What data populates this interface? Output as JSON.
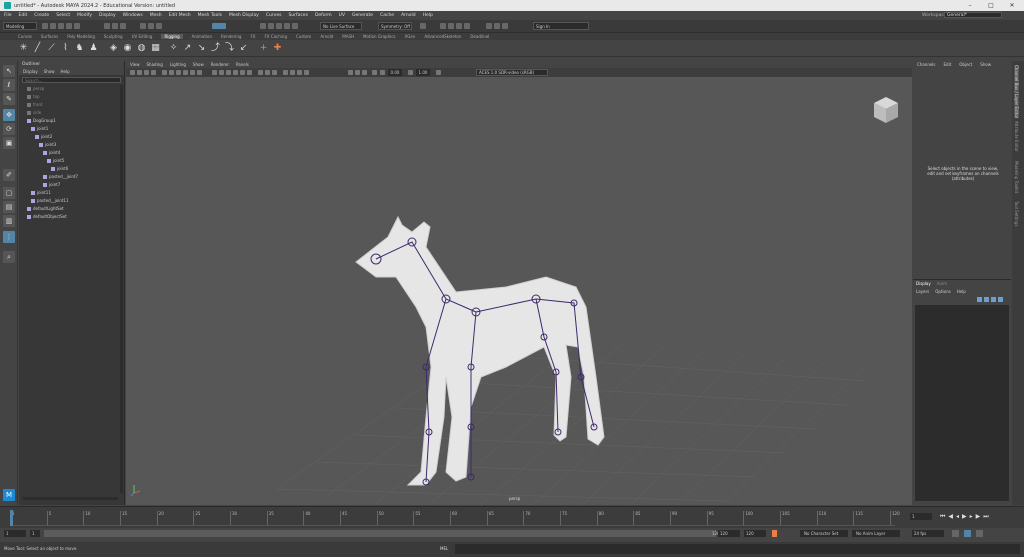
{
  "window": {
    "title": "untitled* - Autodesk MAYA 2024.2 - Educational Version: untitled"
  },
  "menubar": {
    "items": [
      "File",
      "Edit",
      "Create",
      "Select",
      "Modify",
      "Display",
      "Windows",
      "Mesh",
      "Edit Mesh",
      "Mesh Tools",
      "Mesh Display",
      "Curves",
      "Surfaces",
      "Deform",
      "UV",
      "Generate",
      "Cache",
      "Arnold",
      "Help"
    ]
  },
  "workspace": {
    "label": "Workspace:",
    "value": "General*"
  },
  "statusline": {
    "mode": "Modeling",
    "live_surface": "No Live Surface",
    "symmetry": "Symmetry: Off",
    "sign_in": "Sign In"
  },
  "shelf": {
    "tabs": [
      "Curves",
      "Surfaces",
      "Poly Modeling",
      "Sculpting",
      "UV Editing",
      "Rigging",
      "Animation",
      "Rendering",
      "FX",
      "FX Caching",
      "Custom",
      "Arnold",
      "MASH",
      "Motion Graphics",
      "XGen",
      "AdvancedSkeleton",
      "DeadlineI"
    ],
    "active_index": 5
  },
  "outliner": {
    "title": "Outliner",
    "menu": [
      "Display",
      "Show",
      "Help"
    ],
    "search_placeholder": "Search...",
    "rows": [
      {
        "label": "persp",
        "indent": 0,
        "dim": true
      },
      {
        "label": "top",
        "indent": 0,
        "dim": true
      },
      {
        "label": "front",
        "indent": 0,
        "dim": true
      },
      {
        "label": "side",
        "indent": 0,
        "dim": true
      },
      {
        "label": "DogGroup1",
        "indent": 0,
        "dim": false
      },
      {
        "label": "joint1",
        "indent": 1,
        "dim": false
      },
      {
        "label": "joint2",
        "indent": 2,
        "dim": false
      },
      {
        "label": "joint3",
        "indent": 3,
        "dim": false
      },
      {
        "label": "joint4",
        "indent": 4,
        "dim": false
      },
      {
        "label": "joint5",
        "indent": 5,
        "dim": false
      },
      {
        "label": "joint6",
        "indent": 6,
        "dim": false
      },
      {
        "label": "pasted__joint7",
        "indent": 4,
        "dim": false
      },
      {
        "label": "joint7",
        "indent": 4,
        "dim": false
      },
      {
        "label": "joint11",
        "indent": 1,
        "dim": false
      },
      {
        "label": "pasted__joint11",
        "indent": 1,
        "dim": false
      },
      {
        "label": "defaultLightSet",
        "indent": 0,
        "dim": false
      },
      {
        "label": "defaultObjectSet",
        "indent": 0,
        "dim": false
      }
    ]
  },
  "viewport": {
    "menu": [
      "View",
      "Shading",
      "Lighting",
      "Show",
      "Renderer",
      "Panels"
    ],
    "exposure": "0.00",
    "gamma": "1.00",
    "color_space": "ACES 1.0 SDR-video (sRGB)",
    "camera_label": "persp"
  },
  "channelbox": {
    "menu": [
      "Channels",
      "Edit",
      "Object",
      "Show"
    ],
    "message": "Select objects in the scene to view, edit and set keyframes on channels (attributes)",
    "layer_tabs": [
      "Display",
      "Anim"
    ],
    "layer_menu": [
      "Layers",
      "Options",
      "Help"
    ]
  },
  "side_tabs": [
    "Channel Box / Layer Editor",
    "Attribute Editor",
    "Modeling Toolkit",
    "Tool Settings"
  ],
  "timeline": {
    "ticks": [
      "1",
      "5",
      "10",
      "15",
      "20",
      "25",
      "30",
      "35",
      "40",
      "45",
      "50",
      "55",
      "60",
      "65",
      "70",
      "75",
      "80",
      "85",
      "90",
      "95",
      "100",
      "105",
      "110",
      "115",
      "120"
    ],
    "current_frame": "1",
    "range_start": "1",
    "range_inner_start": "1",
    "range_end": "120",
    "range_inner_end": "120",
    "range_bar_end": "120",
    "no_character": "No Character Set",
    "no_anim_layer": "No Anim Layer",
    "fps": "24 fps"
  },
  "helpline": {
    "mel_label": "MEL",
    "status": "Move Tool: Select an object to move."
  },
  "colors": {
    "accent": "#5285a6",
    "joint": "#3e2a6b",
    "active_tab": "#5a5a5a"
  }
}
